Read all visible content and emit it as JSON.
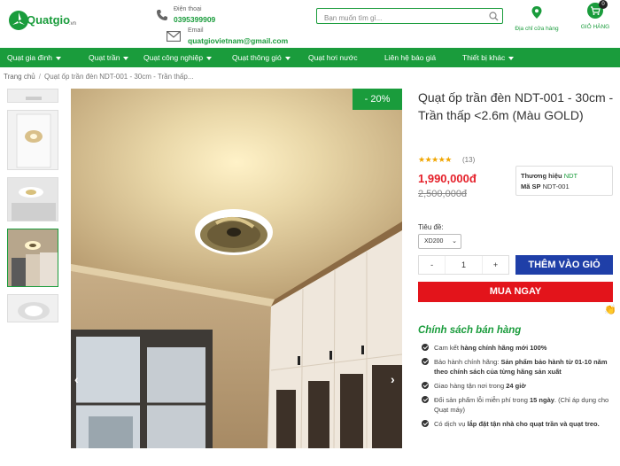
{
  "header": {
    "logo_text": "Quatgio",
    "logo_suffix": "vn",
    "phone_label": "Điện thoại",
    "phone_value": "0395399909",
    "email_label": "Email",
    "email_value": "quatgiovietnam@gmail.com",
    "search_placeholder": "Bạn muốn tìm gì...",
    "store_label": "Địa chỉ cửa hàng",
    "cart_label": "GIỎ HÀNG",
    "cart_count": "0"
  },
  "nav": {
    "items": [
      {
        "label": "Quạt gia đình",
        "has_caret": true
      },
      {
        "label": "Quạt trần",
        "has_caret": true
      },
      {
        "label": "Quạt công nghiệp",
        "has_caret": true
      },
      {
        "label": "Quạt thông gió",
        "has_caret": true
      },
      {
        "label": "Quạt hơi nước",
        "has_caret": false
      },
      {
        "label": "Liên hệ báo giá",
        "has_caret": false
      },
      {
        "label": "Thiết bị khác",
        "has_caret": true
      }
    ]
  },
  "breadcrumb": {
    "home": "Trang chủ",
    "separator": "/",
    "current": "Quạt ốp trần đèn NDT-001 - 30cm - Trần thấp..."
  },
  "product": {
    "discount": "- 20%",
    "title": "Quạt ốp trần đèn NDT-001 - 30cm - Trần thấp <2.6m (Màu GOLD)",
    "rating_stars": "★★★★★",
    "reviews": "(13)",
    "price": "1,990,000đ",
    "old_price": "2,500,000đ",
    "brand_label": "Thương hiệu",
    "brand_value": "NDT",
    "sku_label": "Mã SP",
    "sku_value": "NDT-001",
    "variant_label": "Tiêu đề:",
    "variant_value": "XD200",
    "qty_minus": "-",
    "qty_value": "1",
    "qty_plus": "+",
    "add_to_cart": "THÊM VÀO GIỎ",
    "buy_now": "MUA NGAY"
  },
  "policy": {
    "title": "Chính sách bán hàng",
    "items": [
      {
        "pre": "Cam kết ",
        "bold": "hàng chính hãng mới 100%",
        "post": ""
      },
      {
        "pre": "Bảo hành chính hãng: ",
        "bold": "Sản phẩm bảo hành từ 01-10 năm theo chính sách của từng hãng sản xuất",
        "post": ""
      },
      {
        "pre": "Giao hàng tận nơi trong ",
        "bold": "24 giờ",
        "post": ""
      },
      {
        "pre": "Đổi sản phẩm lỗi miễn phí trong ",
        "bold": "15 ngày",
        "post": ". (Chỉ áp dụng cho Quạt máy)"
      },
      {
        "pre": "Có dịch vụ ",
        "bold": "lắp đặt tận nhà cho quạt trần và quạt treo.",
        "post": ""
      }
    ]
  },
  "colors": {
    "brand_green": "#1a9c3c",
    "price_red": "#e5202a",
    "add_cart_blue": "#1f3fa8",
    "buy_red": "#e3141b"
  }
}
